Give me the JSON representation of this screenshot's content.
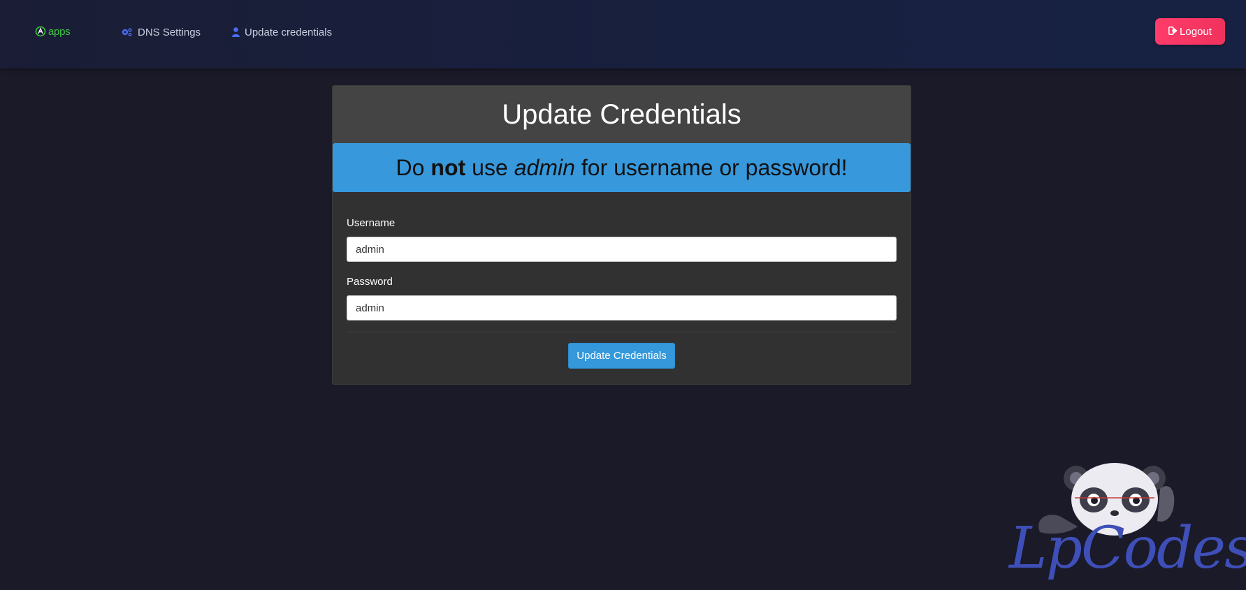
{
  "navbar": {
    "brand_text": "apps",
    "links": [
      {
        "label": "DNS Settings",
        "icon": "gears-icon"
      },
      {
        "label": "Update credentials",
        "icon": "user-icon"
      }
    ],
    "logout_label": "Logout",
    "logout_icon": "sign-out-icon"
  },
  "card": {
    "title": "Update Credentials",
    "warning": {
      "prefix": "Do",
      "bold": "not",
      "middle": "use",
      "italic": "admin",
      "suffix": "for username or password!"
    },
    "username_label": "Username",
    "username_value": "admin",
    "password_label": "Password",
    "password_value": "admin",
    "submit_label": "Update Credentials"
  },
  "watermark": {
    "text": "LpCodes",
    "mascot": "panda-mascot"
  },
  "colors": {
    "background": "#1a1a29",
    "navbar": "#182040",
    "accent_blue": "#3498db",
    "logout": "#ff3b6a",
    "brand_green": "#3ec93e"
  }
}
